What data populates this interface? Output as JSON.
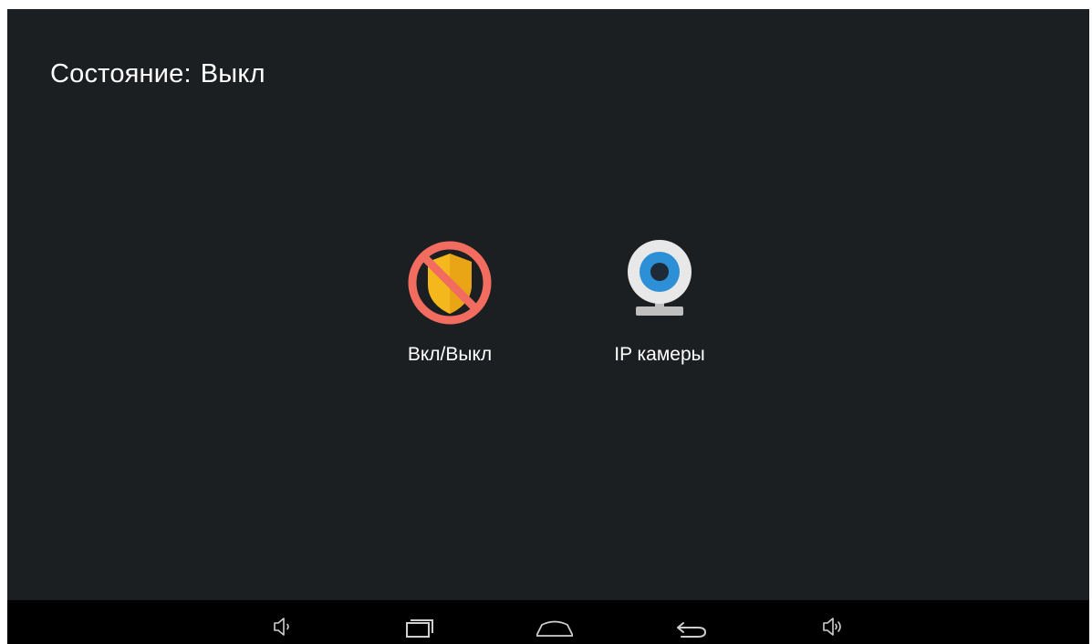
{
  "status": {
    "label": "Состояние:",
    "value": "Выкл"
  },
  "tiles": [
    {
      "label": "Вкл/Выкл",
      "icon": "shield-disabled-icon",
      "colors": {
        "shield": "#f4b81c",
        "forbidden": "#f26c5f"
      }
    },
    {
      "label": "IP камеры",
      "icon": "webcam-icon",
      "colors": {
        "lens": "#2d8fd5",
        "body": "#e8e8e8",
        "pupil": "#1e2a38",
        "stand": "#bfbfbf"
      }
    }
  ],
  "navbar": {
    "buttons": [
      "volume-down-icon",
      "recent-apps-icon",
      "home-icon",
      "back-icon",
      "volume-up-icon"
    ]
  },
  "colors": {
    "background": "#1c1f22",
    "navbar": "#000000",
    "text": "#ffffff"
  }
}
